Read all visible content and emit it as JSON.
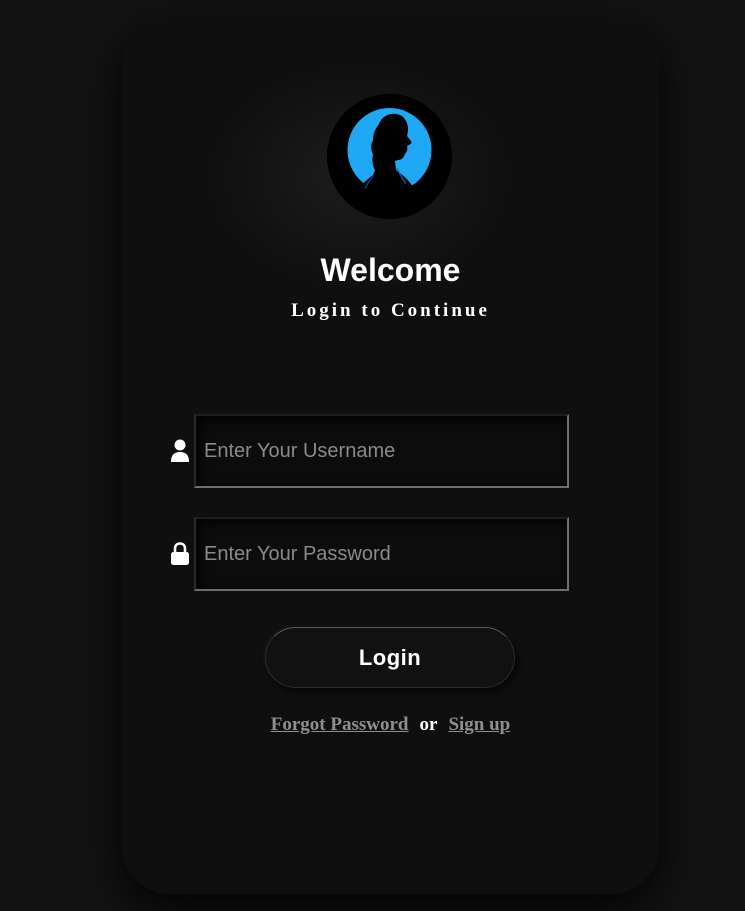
{
  "colors": {
    "page_background": "#121212",
    "card_background": "#0f0f0f",
    "avatar_accent": "#1fa9f5",
    "link_color": "#8f8f8f",
    "text": "#ffffff"
  },
  "header": {
    "avatar_icon": "user-silhouette-icon",
    "title": "Welcome",
    "subtitle": "Login to Continue"
  },
  "form": {
    "username": {
      "icon": "user-icon",
      "value": "",
      "placeholder": "Enter Your Username"
    },
    "password": {
      "icon": "lock-icon",
      "value": "",
      "placeholder": "Enter Your Password"
    },
    "login_label": "Login"
  },
  "links": {
    "forgot_password": "Forgot Password",
    "separator": "or",
    "sign_up": "Sign up"
  }
}
